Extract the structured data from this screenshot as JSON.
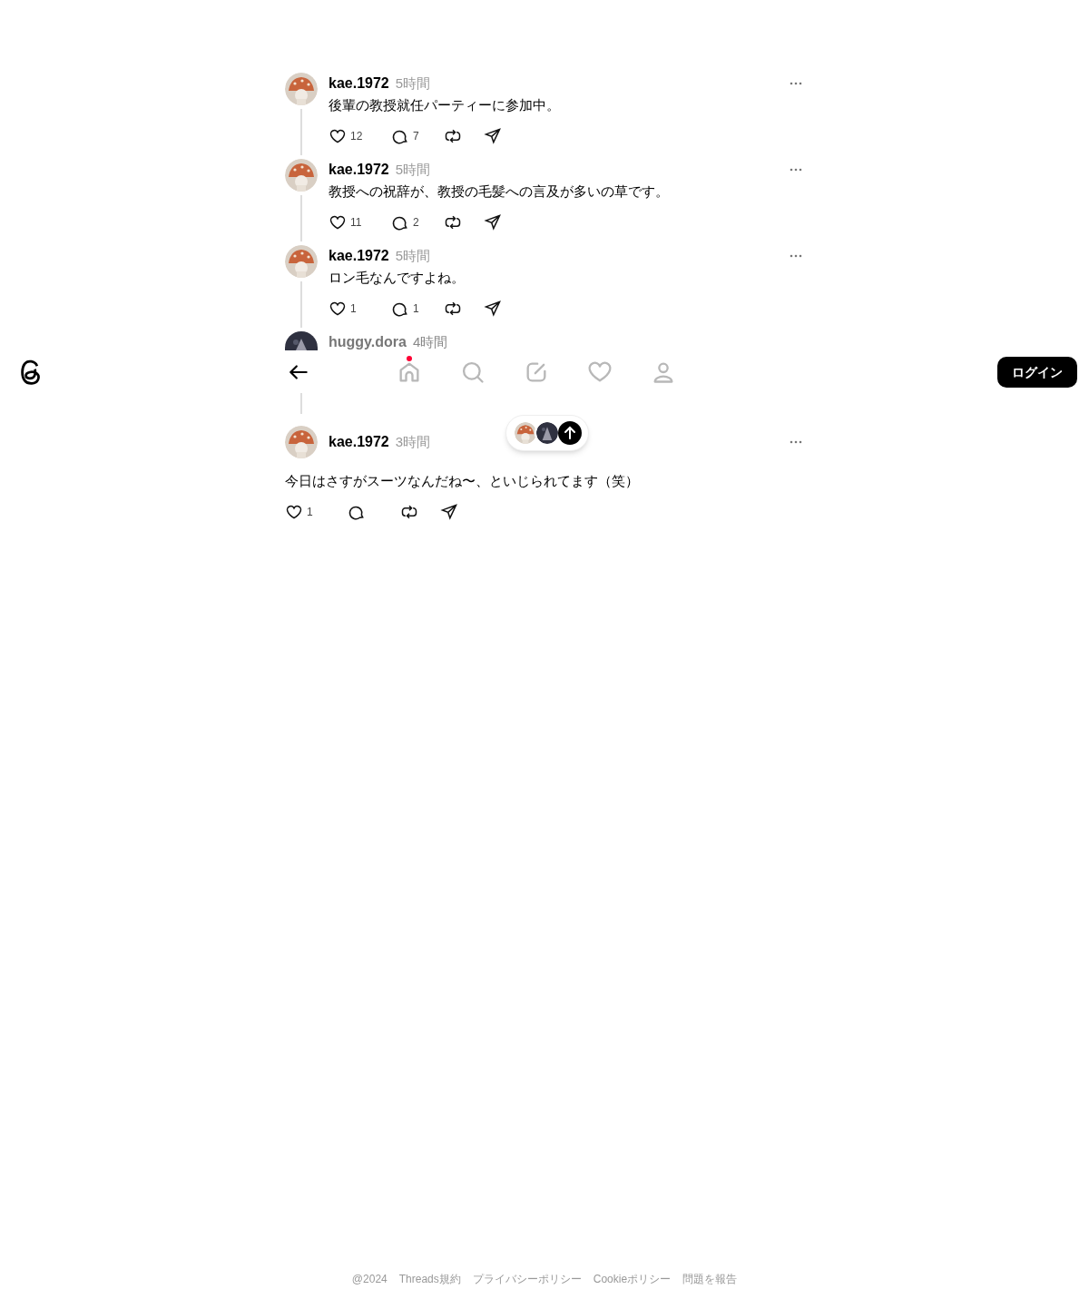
{
  "header": {
    "login_button": "ログイン"
  },
  "nav": {
    "items": [
      {
        "kind": "home",
        "selected": false,
        "unread": true
      },
      {
        "kind": "search",
        "selected": false,
        "unread": false
      },
      {
        "kind": "compose",
        "selected": false,
        "unread": false
      },
      {
        "kind": "activity",
        "selected": false,
        "unread": false
      },
      {
        "kind": "profile",
        "selected": false,
        "unread": false
      }
    ]
  },
  "posts": [
    {
      "kind": "reply",
      "username": "kae.1972",
      "time": "5時間",
      "text": "後輩の教授就任パーティーに参加中。",
      "likes": "12",
      "replies": "7"
    },
    {
      "kind": "reply",
      "username": "kae.1972",
      "time": "5時間",
      "text": "教授への祝辞が、教授の毛髪への言及が多いの草です。",
      "likes": "11",
      "replies": "2"
    },
    {
      "kind": "reply",
      "username": "kae.1972",
      "time": "5時間",
      "text": "ロン毛なんですよね。",
      "likes": "1",
      "replies": "1"
    },
    {
      "kind": "hidden",
      "username": "huggy.dora",
      "time": "4時間"
    },
    {
      "kind": "wide",
      "username": "kae.1972",
      "time": "3時間",
      "text": "今日はさすがスーツなんだね〜、といじられてます（笑）",
      "likes": "1"
    }
  ],
  "footer": [
    "@2024",
    "Threads規約",
    "プライバシーポリシー",
    "Cookieポリシー",
    "問題を報告"
  ]
}
